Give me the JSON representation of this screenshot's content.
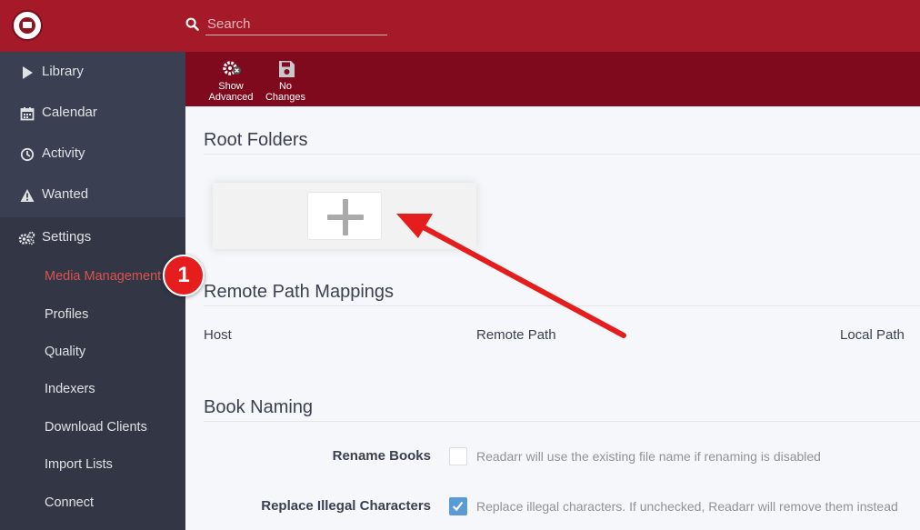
{
  "header": {
    "search": {
      "placeholder": "Search",
      "value": ""
    },
    "logo_icon": "readarr-book-logo"
  },
  "sidebar": {
    "items": [
      {
        "label": "Library",
        "icon": "play-icon"
      },
      {
        "label": "Calendar",
        "icon": "calendar-icon"
      },
      {
        "label": "Activity",
        "icon": "clock-icon"
      },
      {
        "label": "Wanted",
        "icon": "warning-icon"
      },
      {
        "label": "Settings",
        "icon": "gears-icon",
        "active": true
      }
    ],
    "settings_subitems": [
      {
        "label": "Media Management",
        "active": true
      },
      {
        "label": "Profiles"
      },
      {
        "label": "Quality"
      },
      {
        "label": "Indexers"
      },
      {
        "label": "Download Clients"
      },
      {
        "label": "Import Lists"
      },
      {
        "label": "Connect"
      }
    ]
  },
  "toolbar": {
    "show_advanced": {
      "line1": "Show",
      "line2": "Advanced",
      "icon": "gear-x-icon"
    },
    "no_changes": {
      "line1": "No",
      "line2": "Changes",
      "icon": "save-icon"
    }
  },
  "sections": {
    "root_folders": {
      "title": "Root Folders",
      "add_icon": "plus-icon"
    },
    "remote_path_mappings": {
      "title": "Remote Path Mappings",
      "columns": [
        "Host",
        "Remote Path",
        "Local Path"
      ]
    },
    "book_naming": {
      "title": "Book Naming",
      "options": [
        {
          "label": "Rename Books",
          "checked": false,
          "help": "Readarr will use the existing file name if renaming is disabled"
        },
        {
          "label": "Replace Illegal Characters",
          "checked": true,
          "help": "Replace illegal characters. If unchecked, Readarr will remove them instead"
        }
      ]
    }
  },
  "annotation": {
    "marker_number": "1",
    "color": "#e51d1d"
  },
  "colors": {
    "header": "#a61928",
    "toolbar": "#7f0a1e",
    "sidebar": "#3a3f51",
    "active_link": "#d9534f",
    "checkbox_checked": "#5b9bd5"
  }
}
